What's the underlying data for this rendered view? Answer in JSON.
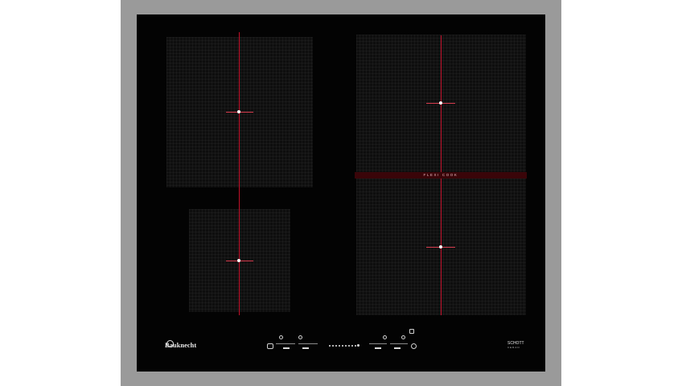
{
  "brand": {
    "name": "Bauknecht"
  },
  "flexi_zone": {
    "label": "FLEXI COOK"
  },
  "glass_brand": {
    "name": "SCHOTT",
    "sub": "CERAN"
  },
  "colors": {
    "frame": "#9a9a9a",
    "glass": "#030303",
    "zone_line": "#c2102a",
    "flexi_band": "#3a0509"
  },
  "controls": {
    "slider_steps": 10
  }
}
